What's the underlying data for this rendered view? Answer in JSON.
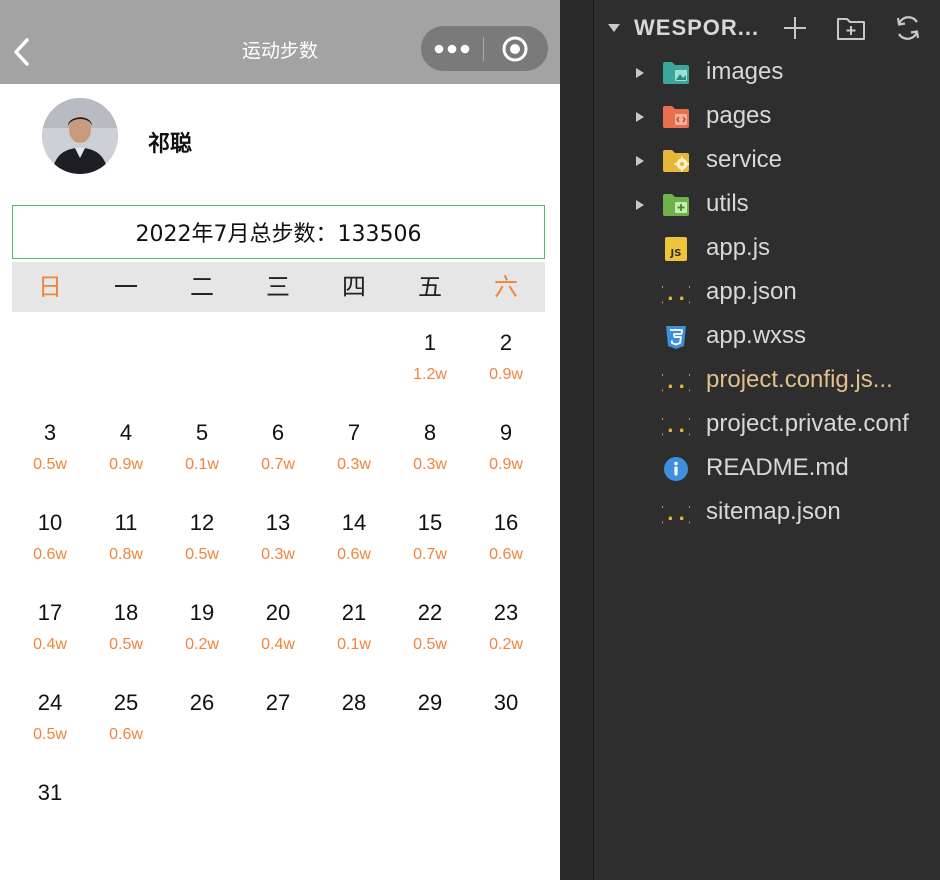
{
  "phone": {
    "nav_title": "运动步数",
    "user_name": "祁聪",
    "total_text": "2022年7月总步数：133506",
    "weekdays": [
      "日",
      "一",
      "二",
      "三",
      "四",
      "五",
      "六"
    ],
    "days": [
      {
        "num": "1",
        "steps": "1.2w"
      },
      {
        "num": "2",
        "steps": "0.9w"
      },
      {
        "num": "3",
        "steps": "0.5w"
      },
      {
        "num": "4",
        "steps": "0.9w"
      },
      {
        "num": "5",
        "steps": "0.1w"
      },
      {
        "num": "6",
        "steps": "0.7w"
      },
      {
        "num": "7",
        "steps": "0.3w"
      },
      {
        "num": "8",
        "steps": "0.3w"
      },
      {
        "num": "9",
        "steps": "0.9w"
      },
      {
        "num": "10",
        "steps": "0.6w"
      },
      {
        "num": "11",
        "steps": "0.8w"
      },
      {
        "num": "12",
        "steps": "0.5w"
      },
      {
        "num": "13",
        "steps": "0.3w"
      },
      {
        "num": "14",
        "steps": "0.6w"
      },
      {
        "num": "15",
        "steps": "0.7w"
      },
      {
        "num": "16",
        "steps": "0.6w"
      },
      {
        "num": "17",
        "steps": "0.4w"
      },
      {
        "num": "18",
        "steps": "0.5w"
      },
      {
        "num": "19",
        "steps": "0.2w"
      },
      {
        "num": "20",
        "steps": "0.4w"
      },
      {
        "num": "21",
        "steps": "0.1w"
      },
      {
        "num": "22",
        "steps": "0.5w"
      },
      {
        "num": "23",
        "steps": "0.2w"
      },
      {
        "num": "24",
        "steps": "0.5w"
      },
      {
        "num": "25",
        "steps": "0.6w"
      },
      {
        "num": "26",
        "steps": ""
      },
      {
        "num": "27",
        "steps": ""
      },
      {
        "num": "28",
        "steps": ""
      },
      {
        "num": "29",
        "steps": ""
      },
      {
        "num": "30",
        "steps": ""
      },
      {
        "num": "31",
        "steps": ""
      }
    ]
  },
  "explorer": {
    "title": "WESPOR...",
    "items": [
      {
        "label": "images",
        "type": "folder",
        "icon": "images-folder-icon",
        "modified": false
      },
      {
        "label": "pages",
        "type": "folder",
        "icon": "pages-folder-icon",
        "modified": false
      },
      {
        "label": "service",
        "type": "folder",
        "icon": "service-folder-icon",
        "modified": false
      },
      {
        "label": "utils",
        "type": "folder",
        "icon": "utils-folder-icon",
        "modified": false
      },
      {
        "label": "app.js",
        "type": "file",
        "icon": "js-file-icon",
        "modified": false
      },
      {
        "label": "app.json",
        "type": "file",
        "icon": "json-file-icon",
        "modified": false
      },
      {
        "label": "app.wxss",
        "type": "file",
        "icon": "css-file-icon",
        "modified": false
      },
      {
        "label": "project.config.js...",
        "type": "file",
        "icon": "json-file-icon",
        "modified": true
      },
      {
        "label": "project.private.conf",
        "type": "file",
        "icon": "json-file-icon",
        "modified": false
      },
      {
        "label": "README.md",
        "type": "file",
        "icon": "info-icon",
        "modified": false
      },
      {
        "label": "sitemap.json",
        "type": "file",
        "icon": "json-file-icon",
        "modified": false
      }
    ]
  },
  "colors": {
    "navbar": "#a3a3a3",
    "accent_orange": "#f0843a",
    "total_border": "#4fbf60",
    "explorer_bg": "#2e2e2e",
    "modified_text": "#e2c08d"
  }
}
